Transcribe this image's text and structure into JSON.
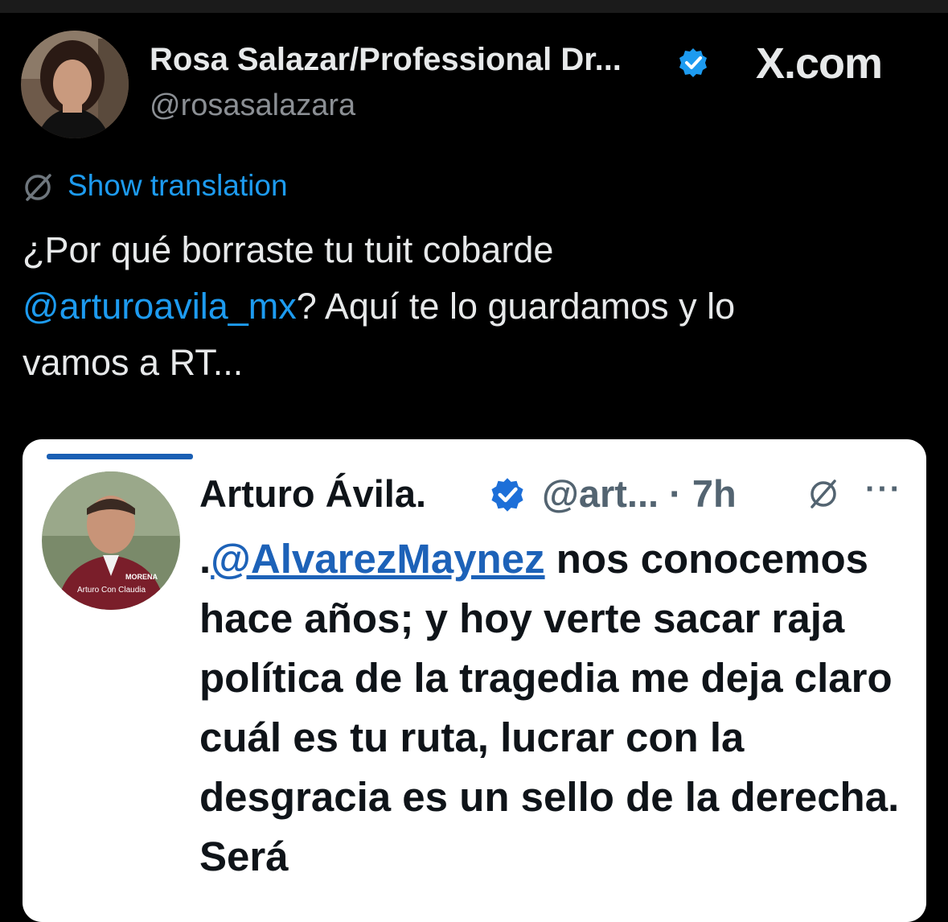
{
  "header": {
    "display_name": "Rosa Salazar/Professional Dr...",
    "handle": "@rosasalazara",
    "site": "X.com"
  },
  "translation": {
    "label": "Show translation"
  },
  "tweet": {
    "line1": "¿Por qué borraste tu tuit cobarde",
    "mention": "@arturoavila_mx",
    "line2_rest": "? Aquí te lo guardamos y lo",
    "line3": "vamos a RT..."
  },
  "quoted": {
    "name": "Arturo Ávila.",
    "handle_time": "@art... · 7h",
    "more": "···",
    "prefix": ".",
    "mention": "@AlvarezMaynez",
    "text_after_mention": " nos conocemos hace años; y hoy verte sacar raja  política de la tragedia me deja claro cuál es tu ruta, lucrar con la desgracia es un sello de la derecha. Será",
    "avatar_caption": "Arturo Con Claudia",
    "avatar_badge": "MORENA"
  },
  "colors": {
    "background": "#000000",
    "link": "#1d9bf0",
    "verified": "#1d9bf0",
    "card_background": "#ffffff"
  },
  "icons": {
    "verified": "verified-badge-icon",
    "translate": "translate-globe-icon",
    "more": "more-dots-icon"
  }
}
